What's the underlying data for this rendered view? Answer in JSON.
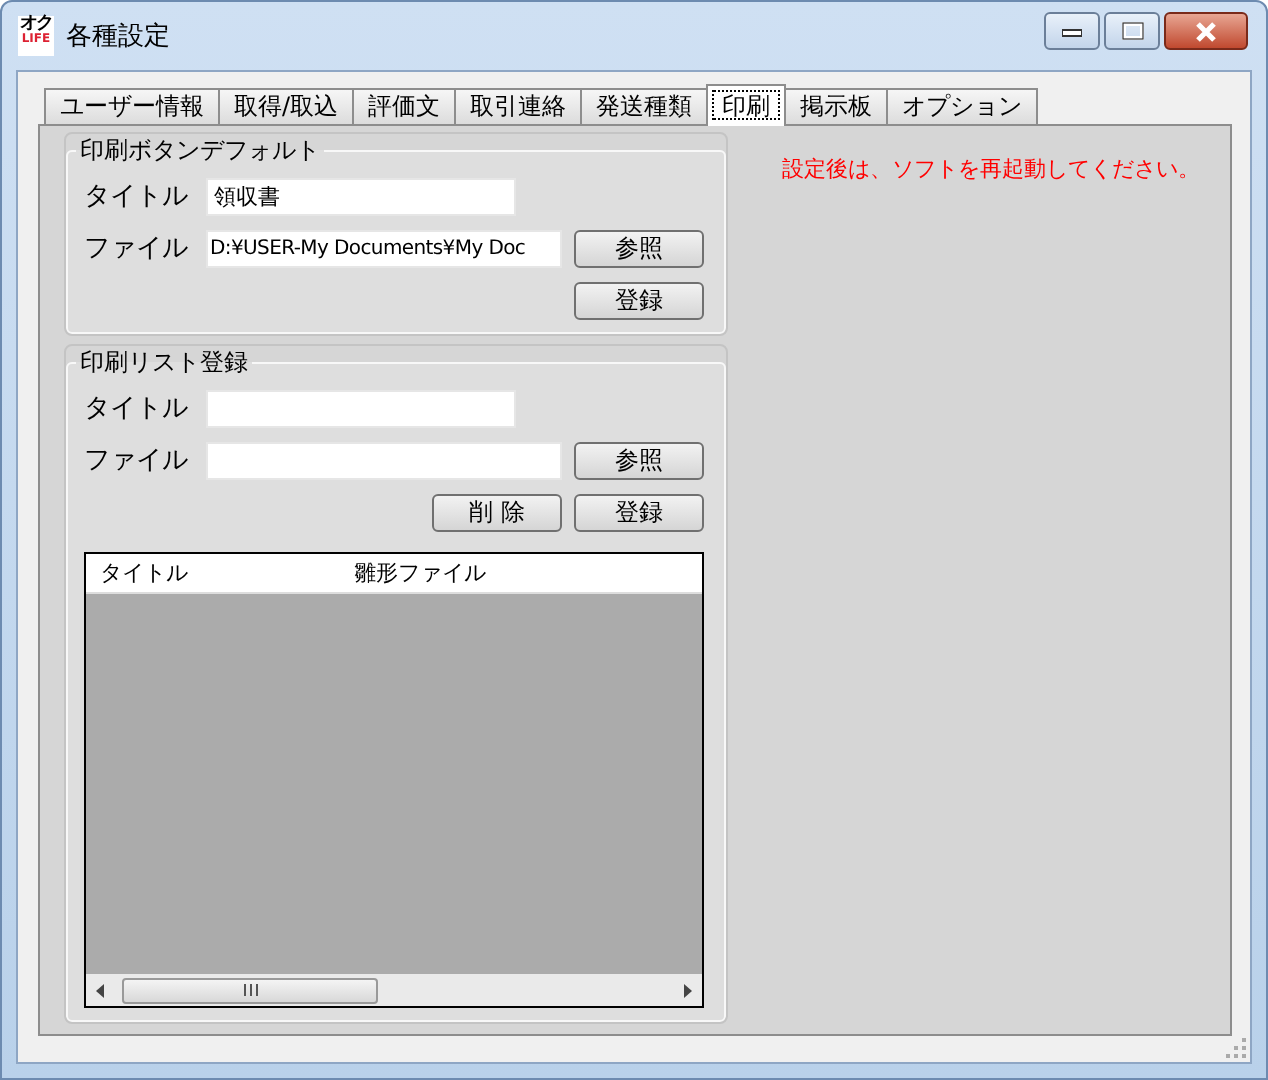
{
  "window": {
    "title": "各種設定",
    "logo": {
      "top": "オク",
      "bottom": "LIFE"
    }
  },
  "tabs": [
    {
      "label": "ユーザー情報",
      "selected": false
    },
    {
      "label": "取得/取込",
      "selected": false
    },
    {
      "label": "評価文",
      "selected": false
    },
    {
      "label": "取引連絡",
      "selected": false
    },
    {
      "label": "発送種類",
      "selected": false
    },
    {
      "label": "印刷",
      "selected": true
    },
    {
      "label": "掲示板",
      "selected": false
    },
    {
      "label": "オプション",
      "selected": false
    }
  ],
  "print_default": {
    "legend": "印刷ボタンデフォルト",
    "title_label": "タイトル",
    "title_value": "領収書",
    "file_label": "ファイル",
    "file_value": "D:¥USER-My Documents¥My Doc",
    "browse_button": "参照",
    "register_button": "登録"
  },
  "print_list": {
    "legend": "印刷リスト登録",
    "title_label": "タイトル",
    "file_label": "ファイル",
    "browse_button": "参照",
    "delete_button": "削 除",
    "register_button": "登録",
    "table": {
      "columns": [
        "タイトル",
        "雛形ファイル"
      ]
    }
  },
  "notice": "設定後は、ソフトを再起動してください。"
}
